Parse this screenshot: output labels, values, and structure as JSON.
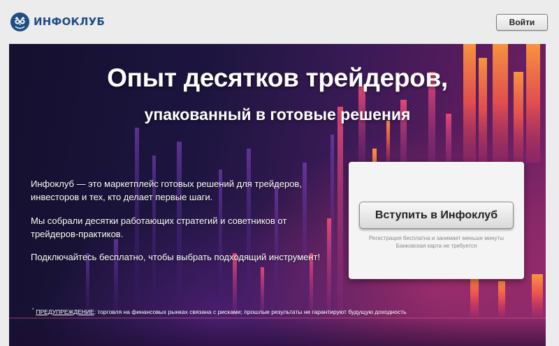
{
  "header": {
    "logo_text": "ИНФОКЛУБ",
    "logo_icon": "owl-icon",
    "login_label": "Войти"
  },
  "hero": {
    "title": "Опыт десятков трейдеров,",
    "subtitle": "упакованный в готовые решения",
    "paragraph_1": "Инфоклуб — это маркетплейс готовых решений для трейдеров, инвесторов и тех, кто делает первые шаги.",
    "paragraph_2": "Мы собрали десятки работающих стратегий и советников от трейдеров-практиков.",
    "paragraph_3": "Подключайтесь бесплатно, чтобы выбрать подходящий инструмент!"
  },
  "signup_card": {
    "join_label": "Вступить в Инфоклуб",
    "note_1": "Регистрация бесплатна и занимает меньше минуты",
    "note_2": "Банковская карта не требуется"
  },
  "warning": {
    "marker": "*",
    "label": "ПРЕДУПРЕЖДЕНИЕ",
    "text": ": торговля на финансовых рынках связана с рисками; прошлые результаты не гарантируют будущую доходность"
  },
  "colors": {
    "brand": "#1f4f82",
    "hero_dark": "#14102e",
    "accent_orange": "#ff7a3a",
    "accent_pink": "#e0356f"
  }
}
